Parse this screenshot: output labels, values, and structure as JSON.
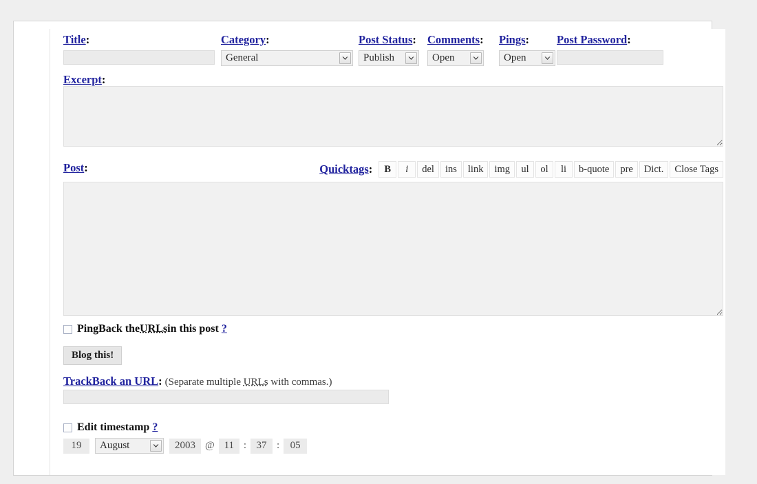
{
  "form": {
    "title": {
      "label": "Title",
      "colon": ":",
      "value": "",
      "placeholder": ""
    },
    "category": {
      "label": "Category",
      "colon": ":",
      "selected": "General",
      "options": [
        "General"
      ]
    },
    "post_status": {
      "label": "Post Status",
      "colon": ":",
      "selected": "Publish",
      "options": [
        "Publish"
      ]
    },
    "comments": {
      "label": "Comments",
      "colon": ":",
      "selected": "Open",
      "options": [
        "Open"
      ]
    },
    "pings": {
      "label": "Pings",
      "colon": ":",
      "selected": "Open",
      "options": [
        "Open"
      ]
    },
    "post_password": {
      "label": "Post Password",
      "colon": ":",
      "value": "",
      "placeholder": ""
    },
    "excerpt": {
      "label": "Excerpt",
      "colon": ":",
      "value": ""
    },
    "post": {
      "label": "Post",
      "colon": ":",
      "value": ""
    },
    "quicktags": {
      "label": "Quicktags",
      "colon": ":",
      "buttons": [
        "B",
        "i",
        "del",
        "ins",
        "link",
        "img",
        "ul",
        "ol",
        "li",
        "b-quote",
        "pre",
        "Dict.",
        "Close Tags"
      ]
    },
    "pingback": {
      "checked": false,
      "text_before": "PingBack the ",
      "abbr": "URLs",
      "text_after": " in this post",
      "help_link": "?"
    },
    "blog_this": {
      "label": "Blog this!"
    },
    "trackback": {
      "label": "TrackBack an URL",
      "colon": ":",
      "note_before": "(Separate multiple ",
      "note_abbr": "URLs",
      "note_after": " with commas.)",
      "value": ""
    },
    "timestamp": {
      "checked": false,
      "label": "Edit timestamp",
      "help_link": "?",
      "day": "19",
      "month": "August",
      "month_options": [
        "August"
      ],
      "year": "2003",
      "at": "@",
      "hour": "11",
      "sep1": ":",
      "minute": "37",
      "sep2": ":",
      "second": "05"
    }
  },
  "colors": {
    "label_link": "#21239e",
    "page_background": "#efefef",
    "panel_background": "#ffffff",
    "field_background": "#ebebeb",
    "textarea_background": "#f1f1f1",
    "button_background": "#e6e6e6"
  }
}
